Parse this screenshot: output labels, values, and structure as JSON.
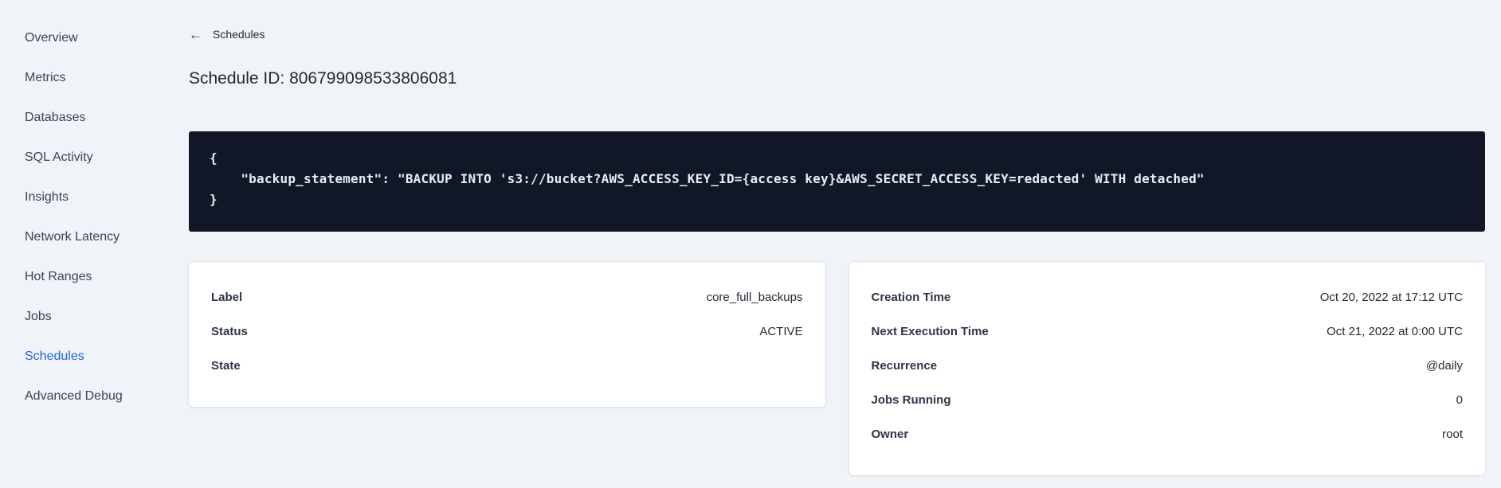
{
  "sidebar": {
    "items": [
      {
        "label": "Overview",
        "active": false
      },
      {
        "label": "Metrics",
        "active": false
      },
      {
        "label": "Databases",
        "active": false
      },
      {
        "label": "SQL Activity",
        "active": false
      },
      {
        "label": "Insights",
        "active": false
      },
      {
        "label": "Network Latency",
        "active": false
      },
      {
        "label": "Hot Ranges",
        "active": false
      },
      {
        "label": "Jobs",
        "active": false
      },
      {
        "label": "Schedules",
        "active": true
      },
      {
        "label": "Advanced Debug",
        "active": false
      }
    ]
  },
  "header": {
    "back_icon": "←",
    "back_label": "Schedules",
    "title": "Schedule ID: 806799098533806081"
  },
  "code_block": {
    "lines": [
      {
        "text": "{"
      },
      {
        "text": "    \"backup_statement\": \"BACKUP INTO 's3://bucket?AWS_ACCESS_KEY_ID={access key}&AWS_SECRET_ACCESS_KEY=redacted' WITH detached\""
      },
      {
        "text": "}"
      }
    ]
  },
  "details_card": {
    "rows": [
      {
        "label": "Label",
        "value": "core_full_backups"
      },
      {
        "label": "Status",
        "value": "ACTIVE"
      },
      {
        "label": "State",
        "value": ""
      }
    ]
  },
  "schedule_card": {
    "rows": [
      {
        "label": "Creation Time",
        "value": "Oct 20, 2022 at 17:12 UTC"
      },
      {
        "label": "Next Execution Time",
        "value": "Oct 21, 2022 at 0:00 UTC"
      },
      {
        "label": "Recurrence",
        "value": "@daily"
      },
      {
        "label": "Jobs Running",
        "value": "0"
      },
      {
        "label": "Owner",
        "value": "root"
      }
    ]
  },
  "colors": {
    "accent_blue": "#1f63e8",
    "page_background": "#f0f4f8",
    "code_background": "#111726",
    "text_dark": "#242a35"
  }
}
